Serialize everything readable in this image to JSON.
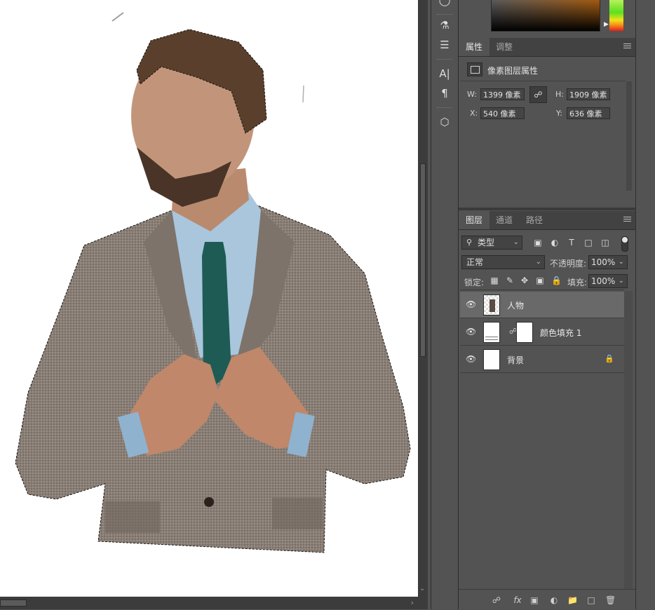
{
  "canvas": {
    "image_description": "Photo of a bearded man in a grey tweed blazer, light blue shirt and dark green tie, cut out with a marching-ants selection on a white background"
  },
  "toolbar": {
    "tools": [
      "brush-settings-icon",
      "adjust-icon",
      "type-icon",
      "paragraph-icon",
      "3d-icon"
    ],
    "type_label": "A|",
    "para_label": "¶"
  },
  "color": {
    "gradient_base": "#a45b10"
  },
  "properties_panel": {
    "tabs": [
      "属性",
      "调整"
    ],
    "active_tab": "属性",
    "title": "像素图层属性",
    "w_label": "W:",
    "w_value": "1399 像素",
    "h_label": "H:",
    "h_value": "1909 像素",
    "x_label": "X:",
    "x_value": "540 像素",
    "y_label": "Y:",
    "y_value": "636 像素",
    "link_icon": "link-icon"
  },
  "layers_panel": {
    "tabs": [
      "图层",
      "通道",
      "路径"
    ],
    "active_tab": "图层",
    "filter_label": "类型",
    "blend_mode": "正常",
    "opacity_label": "不透明度:",
    "opacity_value": "100%",
    "lock_label": "锁定:",
    "fill_label": "填充:",
    "fill_value": "100%",
    "layers": [
      {
        "name": "人物",
        "active": true
      },
      {
        "name": "颜色填充 1",
        "active": false
      },
      {
        "name": "背景",
        "active": false,
        "locked": true
      }
    ],
    "footer_icons": [
      "link-layers-icon",
      "fx-icon",
      "mask-icon",
      "adjustment-icon",
      "group-icon",
      "new-layer-icon",
      "delete-icon"
    ],
    "fx_label": "fx"
  }
}
